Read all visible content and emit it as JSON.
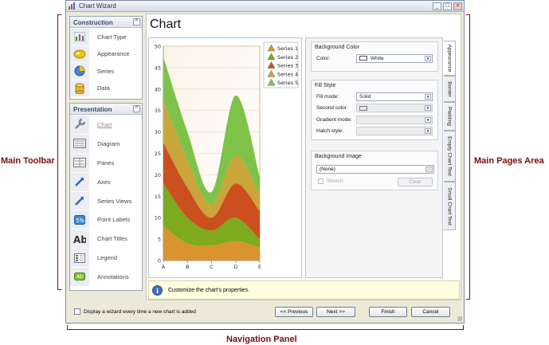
{
  "annotations": {
    "left": "Main Toolbar",
    "right": "Main Pages Area",
    "bottom": "Navigation Panel"
  },
  "window": {
    "title": "Chart Wizard",
    "min": "_",
    "max": "□",
    "close": "×"
  },
  "construction": {
    "title": "Construction",
    "collapse": "^",
    "items": [
      {
        "label": "Chart Type",
        "icon": "chart-type-icon"
      },
      {
        "label": "Appearance",
        "icon": "appearance-icon"
      },
      {
        "label": "Series",
        "icon": "series-icon"
      },
      {
        "label": "Data",
        "icon": "data-icon"
      }
    ]
  },
  "presentation": {
    "title": "Presentation",
    "collapse": "^",
    "items": [
      {
        "label": "Chart",
        "icon": "wrench-icon",
        "selected": true
      },
      {
        "label": "Diagram",
        "icon": "diagram-icon"
      },
      {
        "label": "Panes",
        "icon": "panes-icon"
      },
      {
        "label": "Axes",
        "icon": "axes-icon"
      },
      {
        "label": "Series Views",
        "icon": "series-views-icon"
      },
      {
        "label": "Point Labels",
        "icon": "point-labels-icon"
      },
      {
        "label": "Chart Titles",
        "icon": "chart-titles-icon"
      },
      {
        "label": "Legend",
        "icon": "legend-icon"
      },
      {
        "label": "Annotations",
        "icon": "annotations-icon"
      }
    ]
  },
  "page": {
    "title": "Chart"
  },
  "chart_data": {
    "type": "area",
    "stacked": true,
    "categories": [
      "A",
      "B",
      "C",
      "D",
      "E"
    ],
    "y_ticks": [
      "0",
      "5",
      "10",
      "15",
      "20",
      "25",
      "30",
      "35",
      "40",
      "45",
      "50"
    ],
    "ylim": [
      0,
      50
    ],
    "grid": true,
    "legend_position": "right",
    "series": [
      {
        "name": "Series 1",
        "color": "#d9942f",
        "values": [
          8,
          4,
          3.5,
          4.5,
          3
        ]
      },
      {
        "name": "Series 2",
        "color": "#7eaa1e",
        "values": [
          10,
          6,
          3.5,
          5.5,
          2
        ]
      },
      {
        "name": "Series 3",
        "color": "#cc4f1f",
        "values": [
          9.5,
          7,
          3,
          8,
          6.5
        ]
      },
      {
        "name": "Series 4",
        "color": "#c9a53a",
        "values": [
          10,
          6.5,
          3,
          6.5,
          4
        ]
      },
      {
        "name": "Series 5",
        "color": "#7ec24a",
        "values": [
          10,
          6.5,
          3,
          14,
          4
        ]
      }
    ]
  },
  "properties": {
    "background_color": {
      "title": "Background Color",
      "color_label": "Color:",
      "color_value": "White",
      "swatch": "#ffffff"
    },
    "fill_style": {
      "title": "Fill Style",
      "fill_mode_label": "Fill mode:",
      "fill_mode_value": "Solid",
      "second_color_label": "Second color:",
      "gradient_mode_label": "Gradient mode:",
      "hatch_style_label": "Hatch style:"
    },
    "background_image": {
      "title": "Background Image",
      "value": "(None)",
      "browse": "...",
      "stretch_label": "Stretch",
      "clear_label": "Clear"
    }
  },
  "tabs": [
    "Appearance",
    "Border",
    "Padding",
    "Empty Chart Text",
    "Small Chart Text"
  ],
  "info": {
    "icon": "i",
    "text": "Customize the chart's properties."
  },
  "navigation": {
    "checkbox_label": "Display a wizard every time a new chart is added",
    "previous": "<< Previous",
    "next": "Next >>",
    "finish": "Finish",
    "cancel": "Cancel"
  }
}
